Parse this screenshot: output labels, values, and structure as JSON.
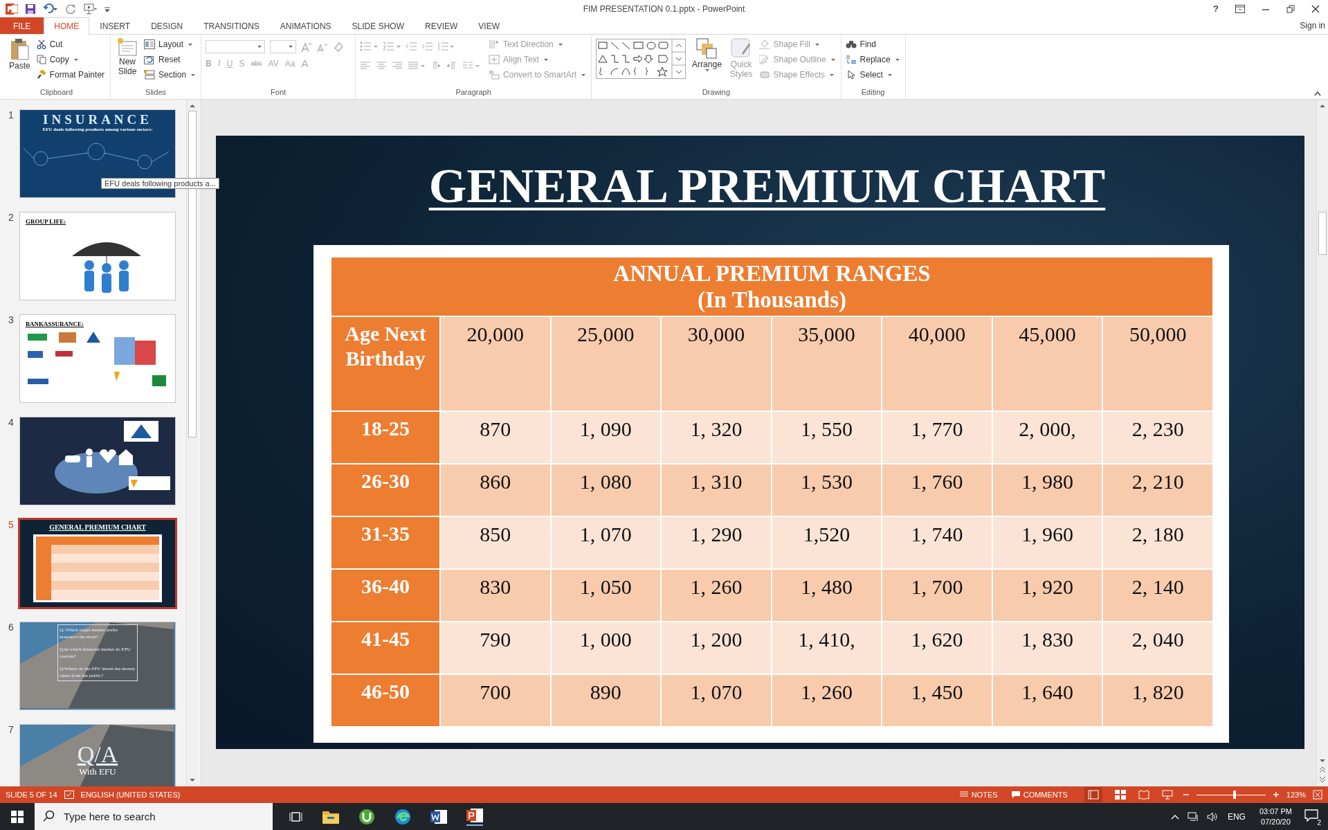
{
  "window": {
    "title": "FIM PRESENTATION 0.1.pptx - PowerPoint",
    "help": "?",
    "sign_in": "Sign in"
  },
  "ribbon_tabs": [
    {
      "label": "FILE",
      "kind": "file",
      "selected": false
    },
    {
      "label": "HOME",
      "kind": "tab",
      "selected": true
    },
    {
      "label": "INSERT",
      "kind": "tab",
      "selected": false
    },
    {
      "label": "DESIGN",
      "kind": "tab",
      "selected": false
    },
    {
      "label": "TRANSITIONS",
      "kind": "tab",
      "selected": false
    },
    {
      "label": "ANIMATIONS",
      "kind": "tab",
      "selected": false
    },
    {
      "label": "SLIDE SHOW",
      "kind": "tab",
      "selected": false
    },
    {
      "label": "REVIEW",
      "kind": "tab",
      "selected": false
    },
    {
      "label": "VIEW",
      "kind": "tab",
      "selected": false
    }
  ],
  "ribbon": {
    "clipboard": {
      "label": "Clipboard",
      "paste": "Paste",
      "cut": "Cut",
      "copy": "Copy",
      "format_painter": "Format Painter"
    },
    "slides": {
      "label": "Slides",
      "new_slide": [
        "New",
        "Slide"
      ],
      "layout": "Layout",
      "reset": "Reset",
      "section": "Section"
    },
    "font": {
      "label": "Font",
      "glyphs": [
        "B",
        "I",
        "U",
        "S",
        "abc",
        "AV",
        "Aa",
        "A"
      ]
    },
    "paragraph": {
      "label": "Paragraph",
      "text_direction": {
        "label": "Text Direction",
        "disabled": true
      },
      "align_text": {
        "label": "Align Text",
        "disabled": true
      },
      "convert": {
        "label": "Convert to SmartArt",
        "disabled": true
      }
    },
    "drawing": {
      "label": "Drawing",
      "arrange": "Arrange",
      "quick_styles": {
        "label": [
          "Quick",
          "Styles"
        ],
        "disabled": true
      },
      "shape_fill": {
        "label": "Shape Fill",
        "disabled": true
      },
      "shape_outline": {
        "label": "Shape Outline",
        "disabled": true
      },
      "shape_effects": {
        "label": "Shape Effects",
        "disabled": true
      }
    },
    "editing": {
      "label": "Editing",
      "find": "Find",
      "replace": "Replace",
      "select": "Select"
    }
  },
  "thumbnails": [
    {
      "number": "1",
      "selected": false,
      "kind": "network",
      "title": "INSURANCE",
      "subtitle": "EFU deals following products among various sectors:"
    },
    {
      "number": "2",
      "selected": false,
      "kind": "umbrella",
      "title": "GROUP LIFE:"
    },
    {
      "number": "3",
      "selected": false,
      "kind": "logos",
      "title": "BANKASSURANCE:"
    },
    {
      "number": "4",
      "selected": false,
      "kind": "hands"
    },
    {
      "number": "5",
      "selected": true,
      "kind": "table",
      "title": "GENERAL PREMIUM CHART"
    },
    {
      "number": "6",
      "selected": false,
      "kind": "building",
      "lines": [
        "Q: Which target market prefer insurance the most?",
        "Q:In which financial market do EFU operate?",
        "Q:Where do the EFU invest the money taken from the public?"
      ]
    },
    {
      "number": "7",
      "selected": false,
      "kind": "building",
      "title": "Q/A",
      "subtitle": "With EFU"
    }
  ],
  "tooltip": "EFU deals following products a...",
  "slide": {
    "title": "GENERAL PREMIUM CHART",
    "table": {
      "heading": [
        "ANNUAL PREMIUM RANGES",
        "(In Thousands)"
      ],
      "columns": [
        "Age Next Birthday",
        "20,000",
        "25,000",
        "30,000",
        "35,000",
        "40,000",
        "45,000",
        "50,000"
      ],
      "rows": [
        [
          "18-25",
          "870",
          "1, 090",
          "1, 320",
          "1, 550",
          "1, 770",
          "2, 000,",
          "2, 230"
        ],
        [
          "26-30",
          "860",
          "1, 080",
          "1, 310",
          "1, 530",
          "1, 760",
          "1, 980",
          "2, 210"
        ],
        [
          "31-35",
          "850",
          "1, 070",
          "1, 290",
          "1,520",
          "1, 740",
          "1, 960",
          "2, 180"
        ],
        [
          "36-40",
          "830",
          "1, 050",
          "1, 260",
          "1, 480",
          "1, 700",
          "1, 920",
          "2, 140"
        ],
        [
          "41-45",
          "790",
          "1, 000",
          "1, 200",
          "1, 410,",
          "1, 620",
          "1, 830",
          "2, 040"
        ],
        [
          "46-50",
          "700",
          "890",
          "1, 070",
          "1, 260",
          "1, 450",
          "1, 640",
          "1, 820"
        ]
      ]
    }
  },
  "status_bar": {
    "slide": "SLIDE 5 OF 14",
    "language": "ENGLISH (UNITED STATES)",
    "notes": "NOTES",
    "comments": "COMMENTS",
    "zoom": "123%",
    "zoom_slider": {
      "level": 0.55
    }
  },
  "taskbar": {
    "search_placeholder": "Type here to search",
    "language": "ENG",
    "time": "03:07 PM",
    "date": "07/20/20",
    "notifications": "2"
  }
}
